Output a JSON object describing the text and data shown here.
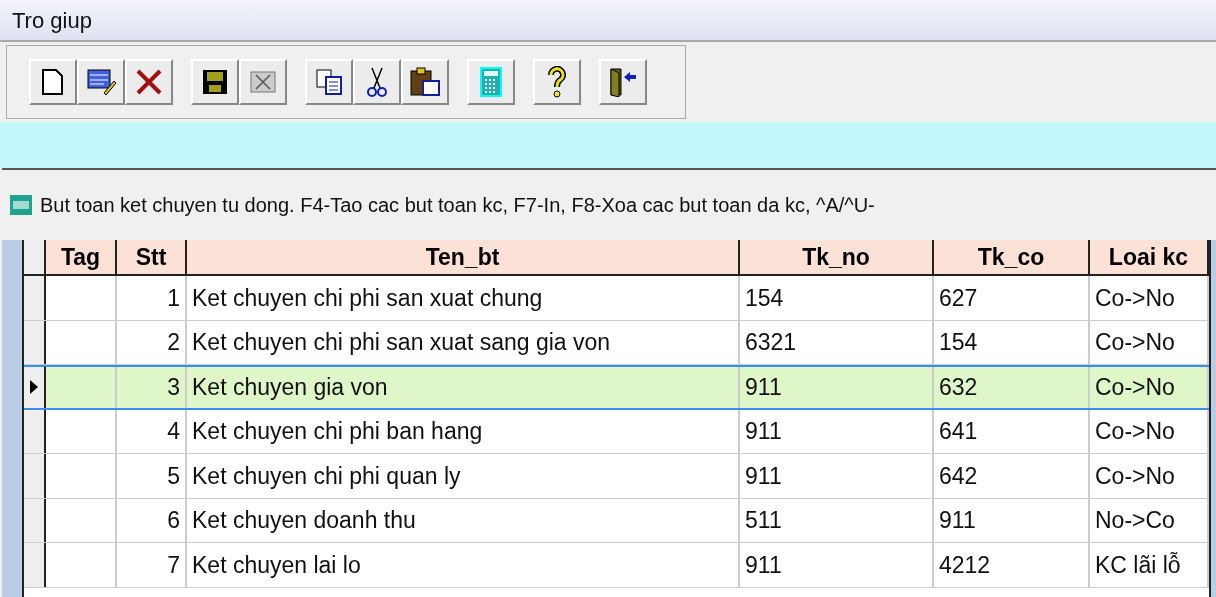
{
  "menu_bar": {
    "items": [
      "Tro giup"
    ]
  },
  "window": {
    "title": "But toan ket chuyen tu dong. F4-Tao cac but toan kc, F7-In, F8-Xoa cac but toan da kc, ^A/^U-"
  },
  "table": {
    "columns": [
      "Tag",
      "Stt",
      "Ten_bt",
      "Tk_no",
      "Tk_co",
      "Loai kc"
    ],
    "rows": [
      {
        "selected": false,
        "cells": [
          "",
          "1",
          "Ket chuyen chi phi san xuat chung",
          "154",
          "627",
          "Co->No"
        ]
      },
      {
        "selected": false,
        "cells": [
          "",
          "2",
          "Ket chuyen chi phi san xuat sang gia von",
          "6321",
          "154",
          "Co->No"
        ]
      },
      {
        "selected": true,
        "cells": [
          "",
          "3",
          "Ket chuyen gia von",
          "911",
          "632",
          "Co->No"
        ]
      },
      {
        "selected": false,
        "cells": [
          "",
          "4",
          "Ket chuyen chi phi ban hang",
          "911",
          "641",
          "Co->No"
        ]
      },
      {
        "selected": false,
        "cells": [
          "",
          "5",
          "Ket chuyen chi phi quan ly",
          "911",
          "642",
          "Co->No"
        ]
      },
      {
        "selected": false,
        "cells": [
          "",
          "6",
          "Ket chuyen doanh thu",
          "511",
          "911",
          "No->Co"
        ]
      },
      {
        "selected": false,
        "cells": [
          "",
          "7",
          "Ket chuyen lai lo",
          "911",
          "4212",
          "KC lãi lỗ"
        ]
      }
    ]
  }
}
